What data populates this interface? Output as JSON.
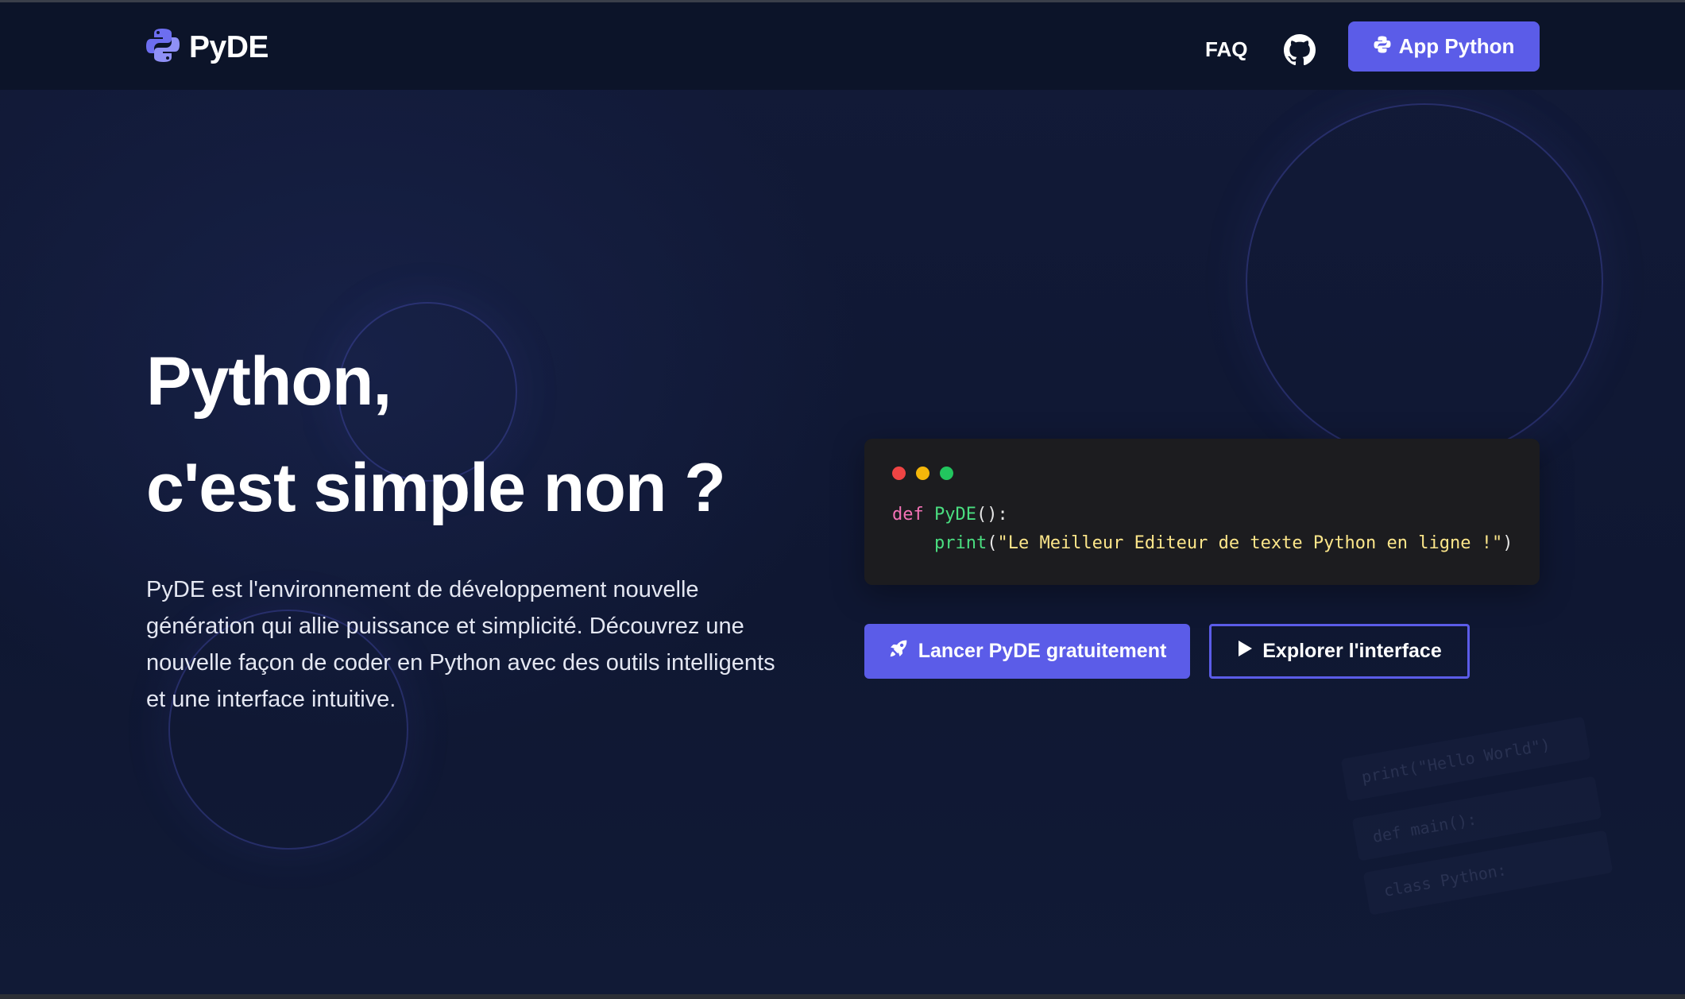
{
  "brand": {
    "name": "PyDE",
    "logo_icon": "python-logo-icon"
  },
  "nav": {
    "faq_label": "FAQ",
    "github_icon": "github-icon",
    "app_button_label": "App Python",
    "app_button_icon": "python-icon"
  },
  "hero": {
    "title_line1": "Python,",
    "title_line2": "c'est simple non ?",
    "description": "PyDE est l'environnement de développement nouvelle génération qui allie puissance et simplicité. Découvrez une nouvelle façon de coder en Python avec des outils intelligents et une interface intuitive."
  },
  "code_window": {
    "dot_colors": [
      "#ef4444",
      "#f5b70a",
      "#22c55e"
    ],
    "line1_keyword": "def",
    "line1_function": "PyDE",
    "line1_rest": "():",
    "line2_indent": "    ",
    "line2_function": "print",
    "line2_open": "(",
    "line2_string": "\"Le Meilleur Editeur de texte Python en ligne !\"",
    "line2_close": ")"
  },
  "actions": {
    "launch_label": "Lancer PyDE gratuitement",
    "launch_icon": "rocket-icon",
    "explore_label": "Explorer l'interface",
    "explore_icon": "play-icon"
  },
  "floating_code": [
    "print(\"Hello World\")",
    "def main():",
    "class Python:"
  ],
  "colors": {
    "accent": "#5b5ce8",
    "background": "#0f1730",
    "navbar": "#0c1429",
    "code_bg": "#1c1c1f"
  }
}
